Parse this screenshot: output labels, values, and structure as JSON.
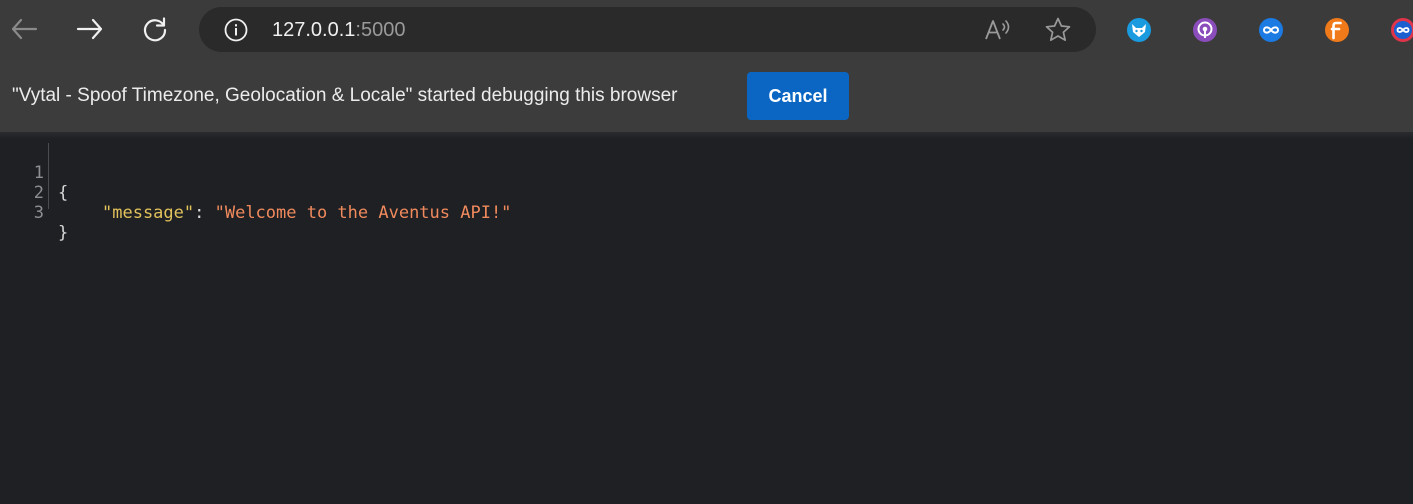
{
  "browser": {
    "address": {
      "host": "127.0.0.1",
      "port": ":5000"
    },
    "extensions": [
      {
        "name": "fox-extension-icon",
        "color": "#1a9be0"
      },
      {
        "name": "podcast-extension-icon",
        "color": "#8a4dbb"
      },
      {
        "name": "infinity-extension-icon",
        "color": "#1b7be3"
      },
      {
        "name": "f-extension-icon",
        "color": "#f07a1a"
      },
      {
        "name": "infinity-red-extension-icon",
        "color": "#e0344a"
      }
    ]
  },
  "infobar": {
    "message": "\"Vytal - Spoof Timezone, Geolocation & Locale\" started debugging this browser",
    "cancel_label": "Cancel"
  },
  "json_view": {
    "line_numbers": [
      "1",
      "2",
      "3"
    ],
    "open_brace": "{",
    "key": "\"message\"",
    "colon": ": ",
    "value": "\"Welcome to the Aventus API!\"",
    "close_brace": "}"
  },
  "colors": {
    "accent": "#0a66c2",
    "json_key": "#e2c25c",
    "json_string": "#f08a5d"
  }
}
